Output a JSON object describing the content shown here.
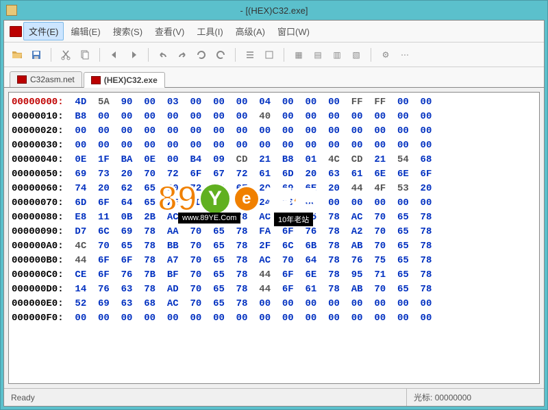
{
  "window": {
    "title": "- [(HEX)C32.exe]"
  },
  "menu": {
    "items": [
      {
        "label": "文件(E)",
        "active": true
      },
      {
        "label": "编辑(E)"
      },
      {
        "label": "搜索(S)"
      },
      {
        "label": "查看(V)"
      },
      {
        "label": "工具(I)"
      },
      {
        "label": "高级(A)"
      },
      {
        "label": "窗口(W)"
      }
    ]
  },
  "tabs": [
    {
      "label": "C32asm.net",
      "active": false
    },
    {
      "label": "(HEX)C32.exe",
      "active": true
    }
  ],
  "hex": {
    "rows": [
      {
        "addr": "00000000:",
        "bytes": [
          "4D",
          "5A",
          "90",
          "00",
          "03",
          "00",
          "00",
          "00",
          "04",
          "00",
          "00",
          "00",
          "FF",
          "FF",
          "00",
          "00"
        ],
        "first": true
      },
      {
        "addr": "00000010:",
        "bytes": [
          "B8",
          "00",
          "00",
          "00",
          "00",
          "00",
          "00",
          "00",
          "40",
          "00",
          "00",
          "00",
          "00",
          "00",
          "00",
          "00"
        ]
      },
      {
        "addr": "00000020:",
        "bytes": [
          "00",
          "00",
          "00",
          "00",
          "00",
          "00",
          "00",
          "00",
          "00",
          "00",
          "00",
          "00",
          "00",
          "00",
          "00",
          "00"
        ]
      },
      {
        "addr": "00000030:",
        "bytes": [
          "00",
          "00",
          "00",
          "00",
          "00",
          "00",
          "00",
          "00",
          "00",
          "00",
          "00",
          "00",
          "00",
          "00",
          "00",
          "00"
        ]
      },
      {
        "addr": "00000040:",
        "bytes": [
          "0E",
          "1F",
          "BA",
          "0E",
          "00",
          "B4",
          "09",
          "CD",
          "21",
          "B8",
          "01",
          "4C",
          "CD",
          "21",
          "54",
          "68"
        ]
      },
      {
        "addr": "00000050:",
        "bytes": [
          "69",
          "73",
          "20",
          "70",
          "72",
          "6F",
          "67",
          "72",
          "61",
          "6D",
          "20",
          "63",
          "61",
          "6E",
          "6E",
          "6F"
        ]
      },
      {
        "addr": "00000060:",
        "bytes": [
          "74",
          "20",
          "62",
          "65",
          "20",
          "72",
          "75",
          "6E",
          "20",
          "69",
          "6E",
          "20",
          "44",
          "4F",
          "53",
          "20"
        ]
      },
      {
        "addr": "00000070:",
        "bytes": [
          "6D",
          "6F",
          "64",
          "65",
          "2E",
          "0D",
          "0D",
          "0A",
          "24",
          "00",
          "00",
          "00",
          "00",
          "00",
          "00",
          "00"
        ]
      },
      {
        "addr": "00000080:",
        "bytes": [
          "E8",
          "11",
          "0B",
          "2B",
          "AC",
          "70",
          "65",
          "78",
          "AC",
          "70",
          "65",
          "78",
          "AC",
          "70",
          "65",
          "78"
        ]
      },
      {
        "addr": "00000090:",
        "bytes": [
          "D7",
          "6C",
          "69",
          "78",
          "AA",
          "70",
          "65",
          "78",
          "FA",
          "6F",
          "76",
          "78",
          "A2",
          "70",
          "65",
          "78"
        ]
      },
      {
        "addr": "000000A0:",
        "bytes": [
          "4C",
          "70",
          "65",
          "78",
          "BB",
          "70",
          "65",
          "78",
          "2F",
          "6C",
          "6B",
          "78",
          "AB",
          "70",
          "65",
          "78"
        ]
      },
      {
        "addr": "000000B0:",
        "bytes": [
          "44",
          "6F",
          "6F",
          "78",
          "A7",
          "70",
          "65",
          "78",
          "AC",
          "70",
          "64",
          "78",
          "76",
          "75",
          "65",
          "78"
        ]
      },
      {
        "addr": "000000C0:",
        "bytes": [
          "CE",
          "6F",
          "76",
          "7B",
          "BF",
          "70",
          "65",
          "78",
          "44",
          "6F",
          "6E",
          "78",
          "95",
          "71",
          "65",
          "78"
        ]
      },
      {
        "addr": "000000D0:",
        "bytes": [
          "14",
          "76",
          "63",
          "78",
          "AD",
          "70",
          "65",
          "78",
          "44",
          "6F",
          "61",
          "78",
          "AB",
          "70",
          "65",
          "78"
        ]
      },
      {
        "addr": "000000E0:",
        "bytes": [
          "52",
          "69",
          "63",
          "68",
          "AC",
          "70",
          "65",
          "78",
          "00",
          "00",
          "00",
          "00",
          "00",
          "00",
          "00",
          "00"
        ]
      },
      {
        "addr": "000000F0:",
        "bytes": [
          "00",
          "00",
          "00",
          "00",
          "00",
          "00",
          "00",
          "00",
          "00",
          "00",
          "00",
          "00",
          "00",
          "00",
          "00",
          "00"
        ]
      }
    ]
  },
  "status": {
    "ready": "Ready",
    "cursor_label": "光标:",
    "cursor_value": "00000000"
  },
  "watermark": {
    "brand1": "89",
    "brand2": "Y",
    "brand3": "e",
    "brand_cn": "源码",
    "url": "www.89YE.Com",
    "tag": "10年老站"
  }
}
